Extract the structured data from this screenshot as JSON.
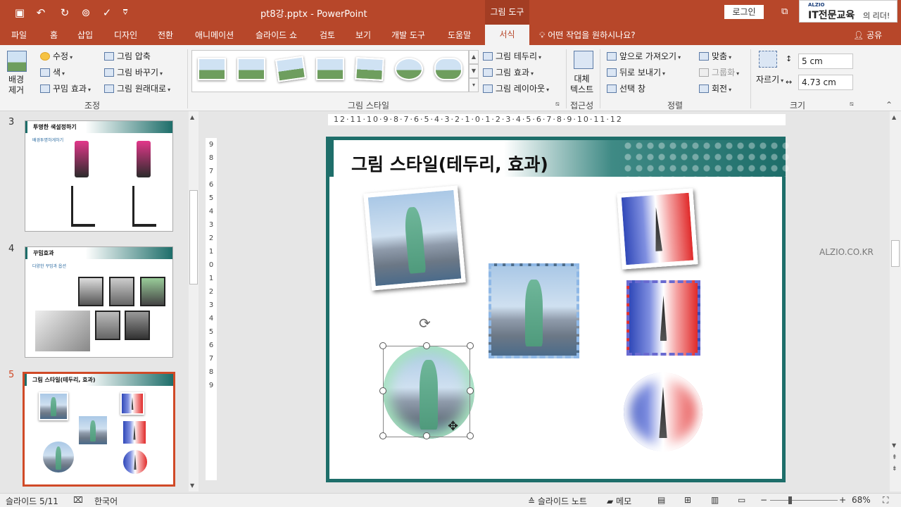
{
  "titlebar": {
    "filename": "pt8강.pptx",
    "separator": "-",
    "app": "PowerPoint",
    "context_tab": "그림 도구",
    "login": "로그인",
    "ad_small": "ALZIO",
    "ad_big": "IT전문교육",
    "ad_rest": "의 리더!"
  },
  "tabs": [
    "파일",
    "홈",
    "삽입",
    "디자인",
    "전환",
    "애니메이션",
    "슬라이드 쇼",
    "검토",
    "보기",
    "개발 도구",
    "도움말"
  ],
  "active_tab": "서식",
  "tellme": "어떤 작업을 원하시나요?",
  "share": "공유",
  "ribbon": {
    "remove_bg": [
      "배경",
      "제거"
    ],
    "adjust": {
      "corrections": "수정",
      "color": "색",
      "artistic": "꾸밈 효과",
      "compress": "그림 압축",
      "change": "그림 바꾸기",
      "reset": "그림 원래대로",
      "label": "조정"
    },
    "styles": {
      "border": "그림 테두리",
      "effects": "그림 효과",
      "layout": "그림 레이아웃",
      "label": "그림 스타일"
    },
    "access": {
      "alt": [
        "대체",
        "텍스트"
      ],
      "label": "접근성"
    },
    "arrange": {
      "forward": "앞으로 가져오기",
      "backward": "뒤로 보내기",
      "pane": "선택 창",
      "align": "맞춤",
      "group": "그룹화",
      "rotate": "회전",
      "label": "정렬"
    },
    "size": {
      "crop": "자르기",
      "height": "5 cm",
      "width": "4.73 cm",
      "label": "크기"
    }
  },
  "thumbnails": [
    {
      "num": "3",
      "title": "투명한 색설정하기",
      "subtitle": "배경투명하게하기"
    },
    {
      "num": "4",
      "title": "꾸밈효과",
      "subtitle": "다양한 꾸밈과 옵션"
    },
    {
      "num": "5",
      "title": "그림 스타일(테두리, 효과)"
    }
  ],
  "ruler": {
    "h": "12·11·10·9·8·7·6·5·4·3·2·1·0·1·2·3·4·5·6·7·8·9·10·11·12",
    "v": [
      "9",
      "8",
      "7",
      "6",
      "5",
      "4",
      "3",
      "2",
      "1",
      "0",
      "1",
      "2",
      "3",
      "4",
      "5",
      "6",
      "7",
      "8",
      "9"
    ]
  },
  "slide": {
    "title": "그림 스타일(테두리, 효과)"
  },
  "watermark": "ALZIO.CO.KR",
  "status": {
    "slide": "슬라이드 5/11",
    "language": "한국어",
    "notes": "슬라이드 노트",
    "comments": "메모",
    "zoom": "68%"
  }
}
